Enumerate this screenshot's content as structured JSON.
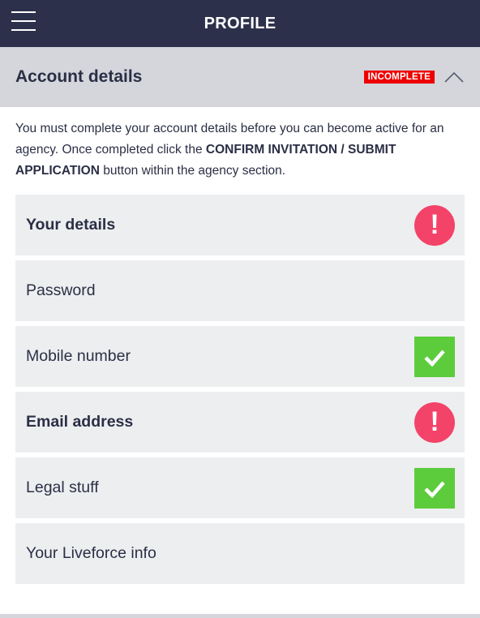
{
  "header": {
    "title": "PROFILE",
    "menu_icon": "hamburger-menu-icon"
  },
  "section": {
    "title": "Account details",
    "badge": "INCOMPLETE",
    "chevron_icon": "chevron-up-icon",
    "intro_part1": "You must complete your account details before you can become active for an agency. Once completed click the ",
    "intro_bold": "CONFIRM INVITATION / SUBMIT APPLICATION",
    "intro_part2": " button within the agency section."
  },
  "items": [
    {
      "label": "Your details",
      "status": "alert",
      "status_text": "!",
      "icon": "exclamation-icon"
    },
    {
      "label": "Password",
      "status": "none"
    },
    {
      "label": "Mobile number",
      "status": "ok",
      "icon": "checkmark-icon"
    },
    {
      "label": "Email address",
      "status": "alert",
      "status_text": "!",
      "icon": "exclamation-icon"
    },
    {
      "label": "Legal stuff",
      "status": "ok",
      "icon": "checkmark-icon"
    },
    {
      "label": "Your Liveforce info",
      "status": "none"
    }
  ],
  "colors": {
    "header_bg": "#2c304b",
    "section_bg": "#d4d6dc",
    "item_bg": "#edeef0",
    "alert": "#f44368",
    "ok": "#5ccc3c",
    "badge": "#ee0000"
  }
}
